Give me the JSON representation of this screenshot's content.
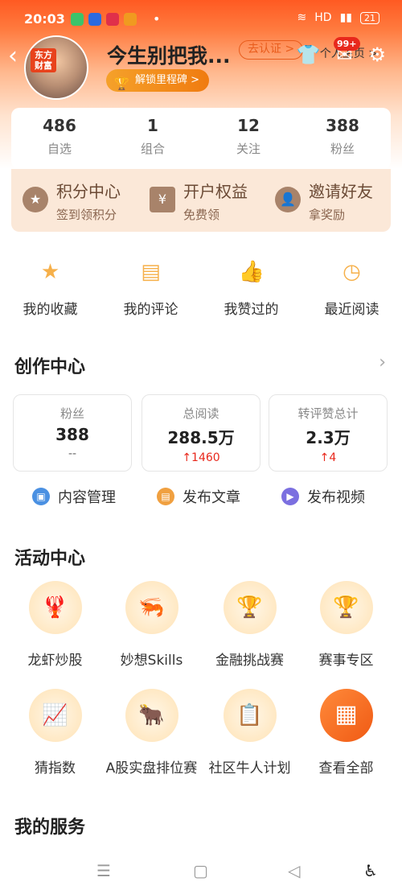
{
  "status_bar": {
    "time": "20:03",
    "network": "HD",
    "battery": "21"
  },
  "profile": {
    "logo_text": "东方财富",
    "username": "今生别把我...",
    "verify_label": "去认证 >",
    "milestone_label": "解锁里程碑 >",
    "homepage_label": "个人主页 >",
    "message_badge": "99+"
  },
  "stats": [
    {
      "value": "486",
      "label": "自选"
    },
    {
      "value": "1",
      "label": "组合"
    },
    {
      "value": "12",
      "label": "关注"
    },
    {
      "value": "388",
      "label": "粉丝"
    }
  ],
  "benefits": [
    {
      "title": "积分中心",
      "sub": "签到领积分",
      "icon": "star-badge-icon"
    },
    {
      "title": "开户权益",
      "sub": "免费领",
      "icon": "yen-card-icon"
    },
    {
      "title": "邀请好友",
      "sub": "拿奖励",
      "icon": "add-user-icon"
    }
  ],
  "quick_links": [
    {
      "label": "我的收藏",
      "icon": "star-icon"
    },
    {
      "label": "我的评论",
      "icon": "comment-icon"
    },
    {
      "label": "我赞过的",
      "icon": "thumbs-up-icon"
    },
    {
      "label": "最近阅读",
      "icon": "clock-icon"
    }
  ],
  "creation": {
    "title": "创作中心",
    "cards": [
      {
        "label": "粉丝",
        "value": "388",
        "delta": "--"
      },
      {
        "label": "总阅读",
        "value": "288.5万",
        "delta": "↑1460"
      },
      {
        "label": "转评赞总计",
        "value": "2.3万",
        "delta": "↑4"
      }
    ],
    "actions": [
      {
        "label": "内容管理",
        "icon": "content-manage-icon"
      },
      {
        "label": "发布文章",
        "icon": "article-icon"
      },
      {
        "label": "发布视频",
        "icon": "video-icon"
      }
    ]
  },
  "activity": {
    "title": "活动中心",
    "items": [
      {
        "label": "龙虾炒股"
      },
      {
        "label": "妙想Skills"
      },
      {
        "label": "金融挑战赛"
      },
      {
        "label": "赛事专区"
      },
      {
        "label": "猜指数"
      },
      {
        "label": "A股实盘排位赛"
      },
      {
        "label": "社区牛人计划"
      },
      {
        "label": "查看全部"
      }
    ]
  },
  "services": {
    "title": "我的服务"
  },
  "colors": {
    "brand": "#ff5a22",
    "accent": "#f07b10",
    "up": "#e8281c"
  }
}
